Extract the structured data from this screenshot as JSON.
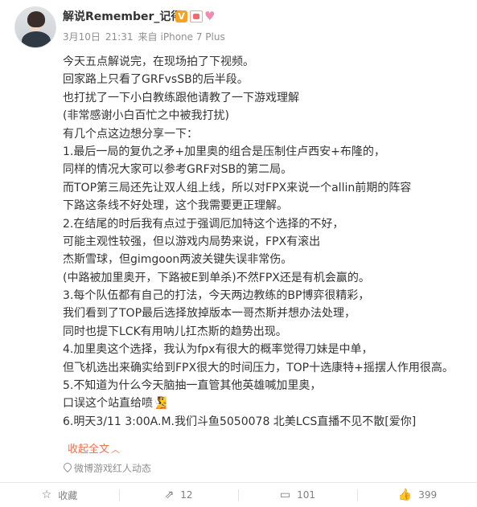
{
  "post": {
    "username": "解说Remember_记得",
    "verified_badge": "V",
    "date": "3月10日",
    "time": "21:31",
    "source_prefix": "来自",
    "device": "iPhone 7 Plus",
    "lines": [
      "今天五点解说完，在现场拍了下视频。",
      "回家路上只看了GRFvsSB的后半段。",
      "也打扰了一下小白教练跟他请教了一下游戏理解",
      "(非常感谢小白百忙之中被我打扰)",
      "有几个点这边想分享一下：",
      "1.最后一局的复仇之矛+加里奥的组合是压制住卢西安+布隆的，",
      "同样的情况大家可以参考GRF对SB的第二局。",
      "而TOP第三局还先让双人组上线，所以对FPX来说一个allin前期的阵容",
      "下路这条线不好处理，这个我需要更正理解。",
      "2.在结尾的时后我有点过于强调厄加特这个选择的不好，",
      "可能主观性较强，但以游戏内局势来说，FPX有滚出",
      "杰斯雪球，但gimgoon两波关键失误非常伤。",
      "(中路被加里奥开，下路被E到单杀)不然FPX还是有机会赢的。",
      "3.每个队伍都有自己的打法，今天两边教练的BP博弈很精彩，",
      "我们看到了TOP最后选择放掉版本一哥杰斯并想办法处理，",
      "同时也提下LCK有用呐儿扛杰斯的趋势出现。",
      "4.加里奥这个选择，我认为fpx有很大的概率觉得刀妹是中单，",
      "但飞机选出来确实给到FPX很大的时间压力，TOP十选康特+摇摆人作用很高。",
      "5.不知道为什么今天脑抽一直管其他英雄喊加里奥，",
      "口误这个站直给喷🧏",
      "6.明天3/11 3:00A.M.我们斗鱼5050078 北美LCS直播不见不散[爱你]"
    ],
    "collapse_label": "收起全文",
    "source_label": "微博游戏红人动态"
  },
  "actions": {
    "collect_label": "收藏",
    "share_count": "12",
    "comment_count": "101",
    "like_count": "399"
  },
  "colors": {
    "accent": "#eb7350",
    "text": "#333333",
    "meta": "#909090"
  },
  "icons": [
    "star-icon",
    "share-icon",
    "comment-icon",
    "like-icon",
    "location-icon",
    "chevron-up-icon"
  ]
}
